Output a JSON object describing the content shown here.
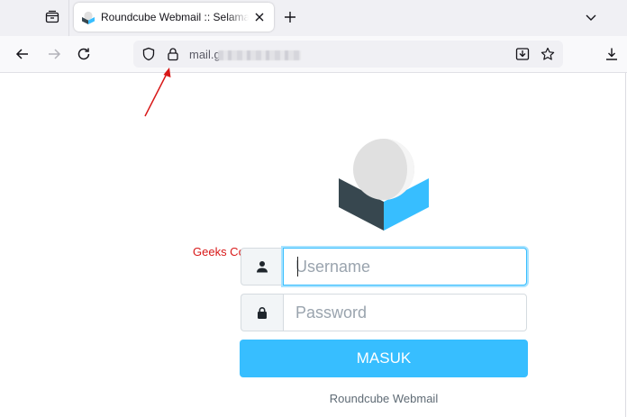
{
  "browser": {
    "tab_title": "Roundcube Webmail :: Selamat Datang di Roundcube Webmail",
    "url_prefix": "mail.g",
    "icons": {
      "tab_overview": "tab-overview-icon",
      "favicon": "roundcube-favicon-icon",
      "close": "close-icon",
      "new_tab": "plus-icon",
      "list_tabs": "chevron-down-icon",
      "back": "arrow-left-icon",
      "forward": "arrow-right-icon",
      "reload": "reload-icon",
      "tracking": "shield-icon",
      "lock": "lock-icon",
      "install": "download-into-icon",
      "bookmark": "star-icon",
      "downloads": "download-icon"
    }
  },
  "annotation": {
    "label": "Geeks Conn",
    "color": "#d81818"
  },
  "login": {
    "username_placeholder": "Username",
    "username_value": "",
    "password_placeholder": "Password",
    "password_value": "",
    "submit_label": "MASUK",
    "product_name": "Roundcube Webmail",
    "accent_color": "#37beff",
    "icons": {
      "user": "user-icon",
      "password": "lock-icon"
    }
  }
}
